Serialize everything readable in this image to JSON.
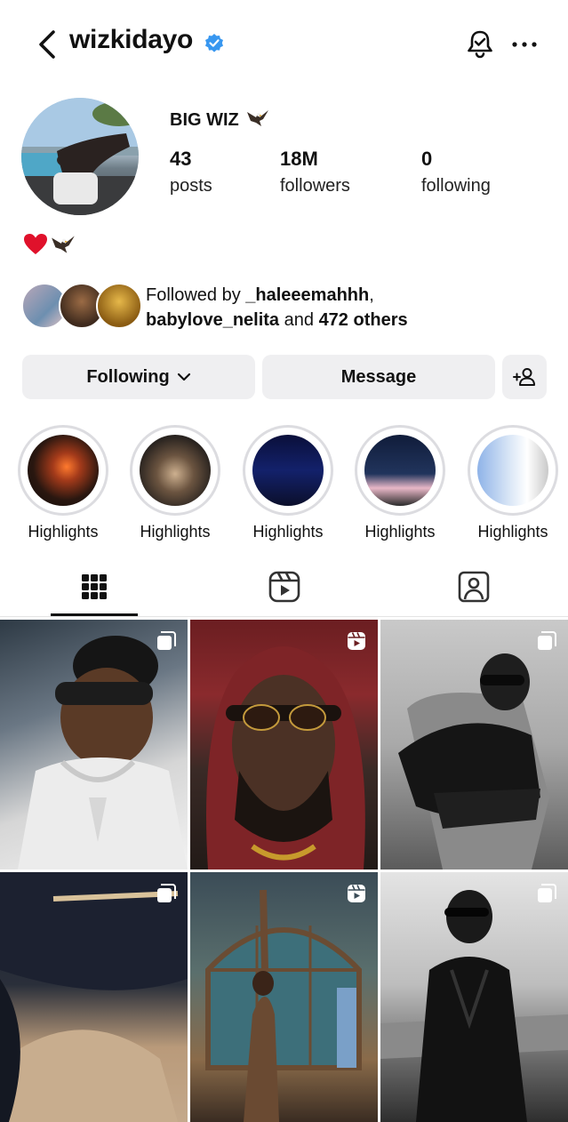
{
  "header": {
    "username": "wizkidayo",
    "verified": true,
    "icons": [
      "back-arrow-icon",
      "verified-badge-icon",
      "notification-bell-icon",
      "more-options-icon"
    ]
  },
  "profile": {
    "display_name": "BIG WIZ",
    "display_name_emoji": "eagle",
    "stats": {
      "posts": {
        "value": "43",
        "label": "posts"
      },
      "followers": {
        "value": "18M",
        "label": "followers"
      },
      "following": {
        "value": "0",
        "label": "following"
      }
    },
    "bio_emojis": [
      "red-heart",
      "eagle"
    ]
  },
  "followed_by": {
    "prefix": "Followed by",
    "user1": "_haleeemahhh",
    "sep": ",",
    "user2": "babylove_nelita",
    "and": "and",
    "others": "472 others"
  },
  "actions": {
    "following_label": "Following",
    "message_label": "Message",
    "suggest_icon": "add-person-icon"
  },
  "highlights": [
    {
      "label": "Highlights"
    },
    {
      "label": "Highlights"
    },
    {
      "label": "Highlights"
    },
    {
      "label": "Highlights"
    },
    {
      "label": "Highlights"
    }
  ],
  "tabs": [
    {
      "icon": "grid-icon",
      "active": true
    },
    {
      "icon": "reels-icon",
      "active": false
    },
    {
      "icon": "tagged-icon",
      "active": false
    }
  ],
  "posts": [
    {
      "badge": "carousel-icon"
    },
    {
      "badge": "reels-icon"
    },
    {
      "badge": "carousel-icon"
    },
    {
      "badge": "carousel-icon"
    },
    {
      "badge": "reels-icon"
    },
    {
      "badge": "carousel-icon"
    }
  ],
  "colors": {
    "verified": "#3897f0",
    "button_bg": "#efeff1",
    "text": "#111111"
  }
}
